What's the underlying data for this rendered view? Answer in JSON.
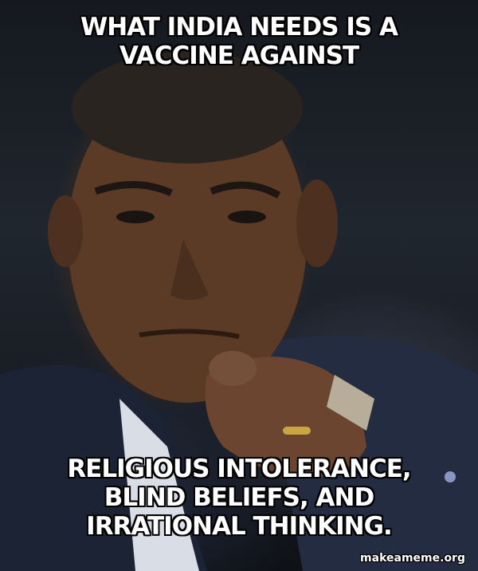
{
  "meme": {
    "top_text": "WHAT INDIA NEEDS IS A VACCINE AGAINST",
    "bottom_text": "RELIGIOUS INTOLERANCE, BLIND BELIEFS, AND IRRATIONAL THINKING.",
    "watermark": "makeameme.org"
  }
}
